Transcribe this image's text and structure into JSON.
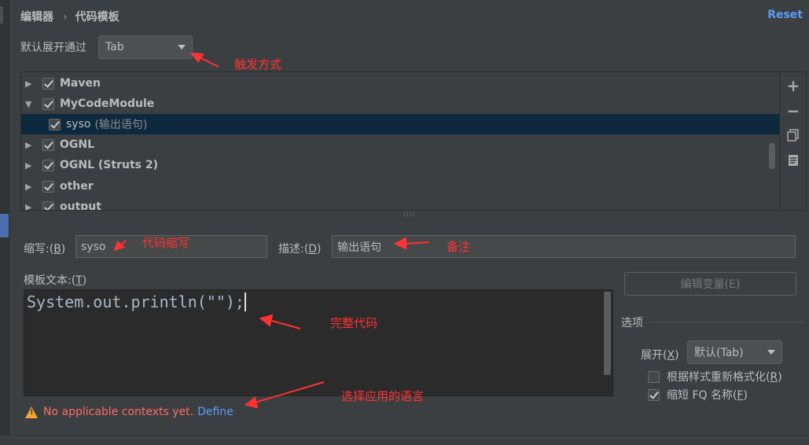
{
  "breadcrumb": {
    "parent": "编辑器",
    "separator": "›",
    "current": "代码模板"
  },
  "reset_label": "Reset",
  "expand_via": {
    "label": "默认展开通过",
    "value": "Tab"
  },
  "tree": {
    "rows": [
      {
        "label": "Maven",
        "expanded": false,
        "checked": true
      },
      {
        "label": "MyCodeModule",
        "expanded": true,
        "checked": true
      },
      {
        "label": "syso",
        "note": "(输出语句)",
        "checked": true,
        "selected": true
      },
      {
        "label": "OGNL",
        "expanded": false,
        "checked": true
      },
      {
        "label": "OGNL (Struts 2)",
        "expanded": false,
        "checked": true
      },
      {
        "label": "other",
        "expanded": false,
        "checked": true
      },
      {
        "label": "output",
        "expanded": false,
        "checked": true
      }
    ],
    "toolbar": {
      "add": "+",
      "remove": "−"
    }
  },
  "abbreviation": {
    "label": "缩写:(",
    "mnemonic": "B",
    "suffix": ")",
    "value": "syso"
  },
  "description": {
    "label": "描述:(",
    "mnemonic": "D",
    "suffix": ")",
    "value": "输出语句"
  },
  "template_text": {
    "label": "模板文本:(",
    "mnemonic": "T",
    "suffix": ")",
    "code": "System.out.println(\"\");"
  },
  "edit_variables_label": "编辑变量(E)",
  "options": {
    "title": "选项",
    "expand_label": "展开(",
    "expand_mnemonic": "X",
    "expand_suffix": ")",
    "expand_value": "默认(Tab)",
    "reformat_label": "根据样式重新格式化(",
    "reformat_mnemonic": "R",
    "reformat_suffix": ")",
    "reformat_checked": false,
    "shorten_label": "缩短 FQ 名称(",
    "shorten_mnemonic": "F",
    "shorten_suffix": ")",
    "shorten_checked": true
  },
  "warning": {
    "text": "No applicable contexts yet.",
    "link": "Define"
  },
  "annotations": {
    "trigger": "触发方式",
    "abbr": "代码缩写",
    "note": "备注",
    "full_code": "完整代码",
    "language": "选择应用的语言"
  },
  "colors": {
    "annotation": "#ff3333",
    "selection": "#0d293e",
    "link": "#589df6",
    "warning": "#ff6b68"
  }
}
